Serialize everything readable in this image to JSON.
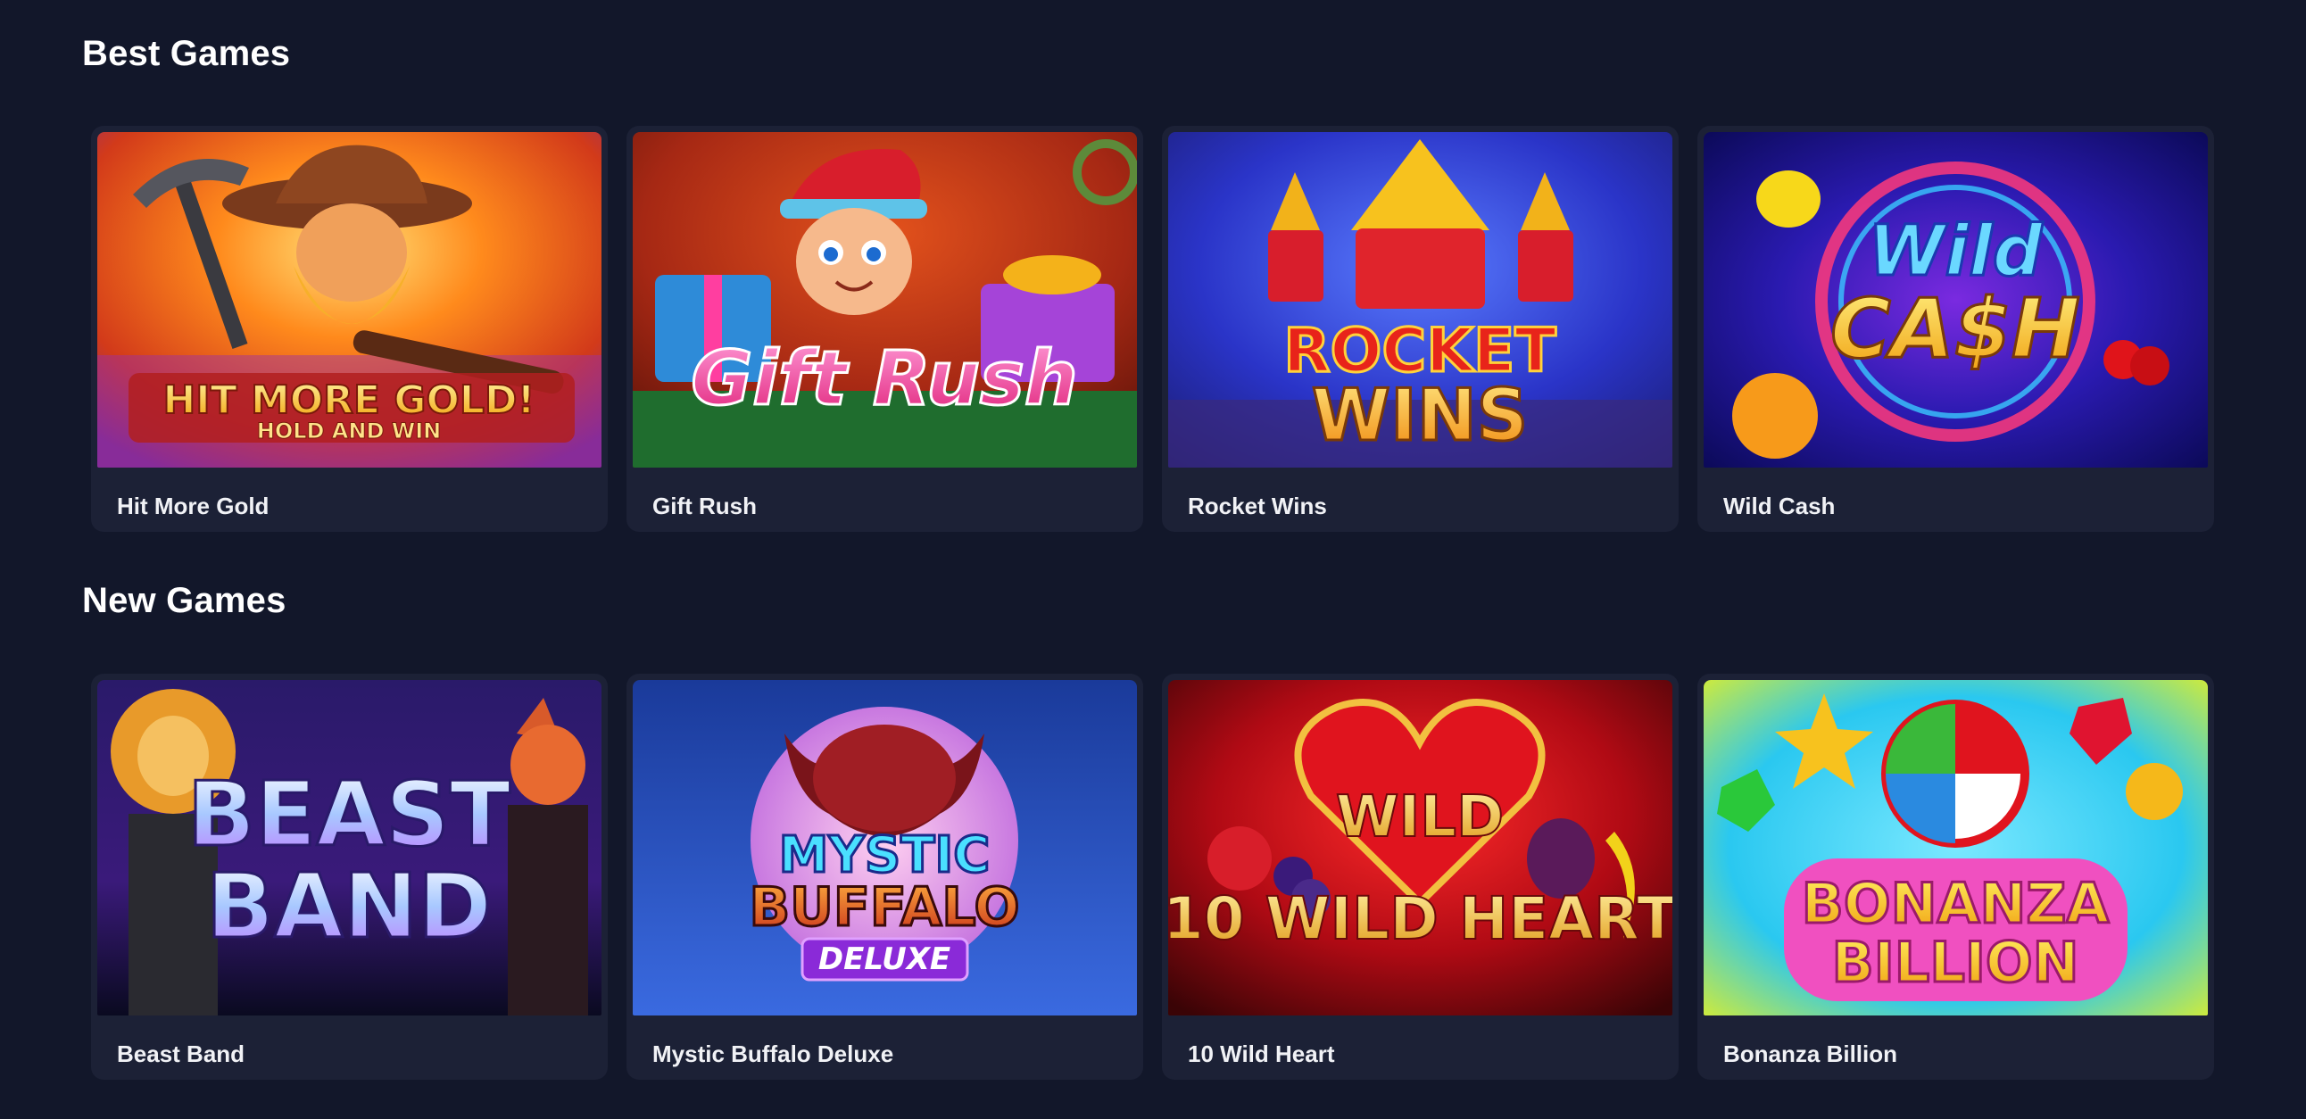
{
  "sections": [
    {
      "title": "Best Games",
      "games": [
        {
          "name": "Hit More Gold",
          "logo_line1": "HIT MORE GOLD!",
          "logo_line2": "HOLD AND WIN"
        },
        {
          "name": "Gift Rush",
          "logo_line1": "Gift Rush",
          "logo_line2": ""
        },
        {
          "name": "Rocket Wins",
          "logo_line1": "ROCKET",
          "logo_line2": "WINS"
        },
        {
          "name": "Wild Cash",
          "logo_line1": "Wild",
          "logo_line2": "CA$H"
        }
      ]
    },
    {
      "title": "New Games",
      "games": [
        {
          "name": "Beast Band",
          "logo_line1": "BEAST",
          "logo_line2": "BAND"
        },
        {
          "name": "Mystic Buffalo Deluxe",
          "logo_line1": "MYSTIC",
          "logo_line2": "BUFFALO",
          "logo_line3": "DELUXE"
        },
        {
          "name": "10 Wild Heart",
          "logo_line1": "WILD",
          "logo_line2": "10 WILD HEART"
        },
        {
          "name": "Bonanza Billion",
          "logo_line1": "BONANZA",
          "logo_line2": "BILLION"
        }
      ]
    }
  ],
  "colors": {
    "background": "#12172a",
    "card": "#1c2136",
    "text": "#ffffff"
  }
}
